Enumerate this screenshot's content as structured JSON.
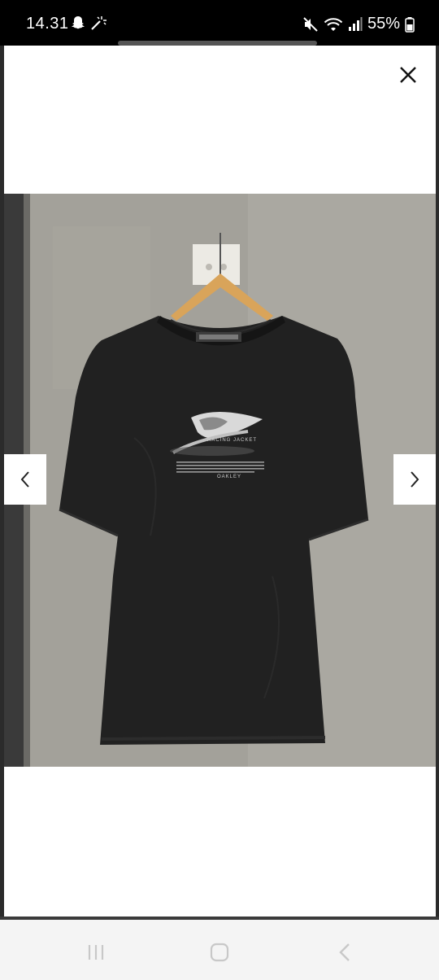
{
  "status_bar": {
    "time": "14.31",
    "battery": "55%",
    "icons": [
      "snapchat-ghost-icon",
      "magic-wand-icon",
      "mute-icon",
      "wifi-icon",
      "signal-icon",
      "battery-icon"
    ]
  },
  "viewer": {
    "close_icon": "close-icon",
    "prev_icon": "chevron-left-icon",
    "next_icon": "chevron-right-icon"
  },
  "photo": {
    "graphic_title": "RACING JACKET",
    "graphic_logo": "OAKLEY"
  },
  "system_nav": {
    "icons": [
      "recent-apps-icon",
      "home-icon",
      "back-icon"
    ]
  }
}
